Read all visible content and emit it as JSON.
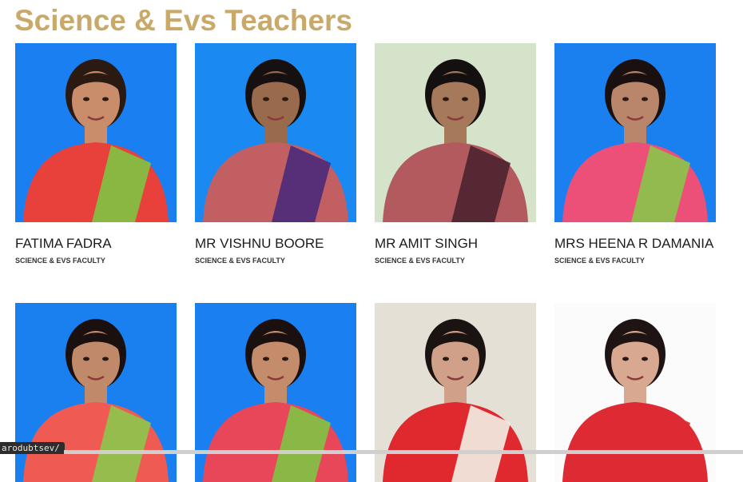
{
  "section": {
    "title": "Science & Evs Teachers"
  },
  "teachers": [
    {
      "name": "FATIMA FADRA",
      "role": "SCIENCE & EVS FACULTY",
      "photo_bg": "#1a7ff0",
      "attire": "#e8403a",
      "shirt2": "#7fc444",
      "hair": "#2a1a12",
      "skin": "#c98d6b"
    },
    {
      "name": "MR VISHNU BOORE",
      "role": "SCIENCE & EVS FACULTY",
      "photo_bg": "#1a8af2",
      "attire": "#c25f63",
      "shirt2": "#4a2a7a",
      "hair": "#161010",
      "skin": "#9a6a4d"
    },
    {
      "name": "MR AMIT SINGH",
      "role": "SCIENCE & EVS FACULTY",
      "photo_bg": "#d4e3c9",
      "attire": "#b25a5e",
      "shirt2": "#4b2230",
      "hair": "#151010",
      "skin": "#a5795a"
    },
    {
      "name": "MRS HEENA R DAMANIA",
      "role": "SCIENCE & EVS FACULTY",
      "photo_bg": "#1a80ef",
      "attire": "#ec4f77",
      "shirt2": "#8ac54a",
      "hair": "#1a1010",
      "skin": "#b9866b"
    },
    {
      "name": "",
      "role": "",
      "photo_bg": "#1a80ef",
      "attire": "#ef5b52",
      "shirt2": "#8cc64c",
      "hair": "#1a1010",
      "skin": "#c08a6a"
    },
    {
      "name": "",
      "role": "",
      "photo_bg": "#1a7ff0",
      "attire": "#e8475a",
      "shirt2": "#7fc444",
      "hair": "#1a1010",
      "skin": "#c48c6b"
    },
    {
      "name": "",
      "role": "",
      "photo_bg": "#e4e0d6",
      "attire": "#e0282f",
      "shirt2": "#f2efe6",
      "hair": "#1b1212",
      "skin": "#d0a088"
    },
    {
      "name": "",
      "role": "",
      "photo_bg": "#fbfbfb",
      "attire": "#de2a33",
      "shirt2": "#de2a33",
      "hair": "#1e1414",
      "skin": "#d8a990"
    }
  ],
  "status_bar": {
    "url": "arodubtsev/"
  }
}
